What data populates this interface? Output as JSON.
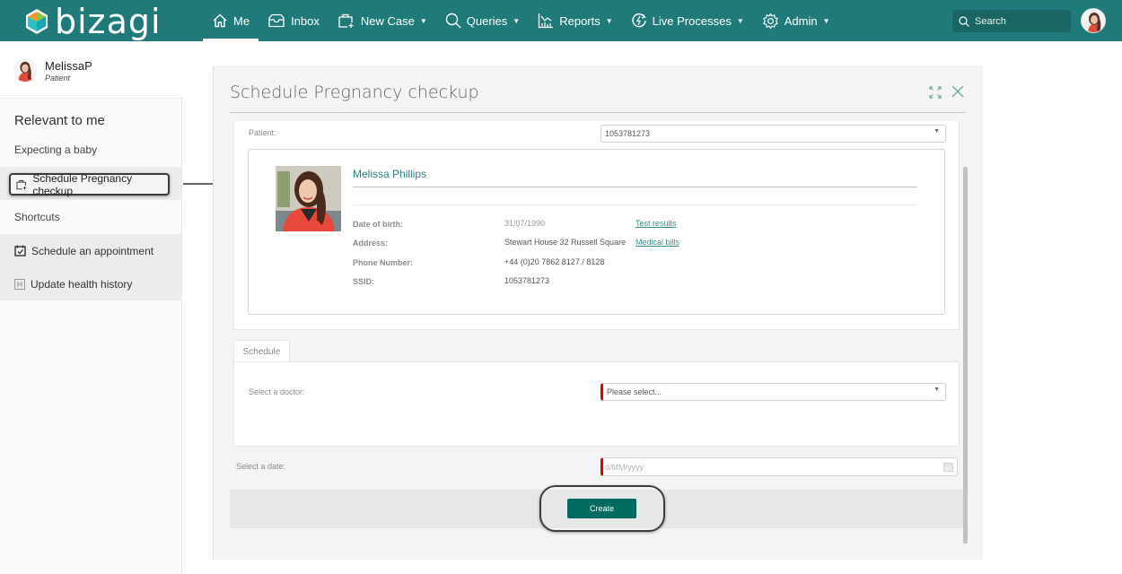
{
  "app": {
    "logo_text": "bizagi",
    "colors": {
      "brand": "#207a79",
      "accent": "#006b5f",
      "required": "#e30000",
      "link": "#3c8e8c"
    }
  },
  "nav": {
    "items": [
      {
        "label": "Me",
        "icon": "home-icon",
        "active": true,
        "has_dropdown": false
      },
      {
        "label": "Inbox",
        "icon": "inbox-icon",
        "active": false,
        "has_dropdown": false
      },
      {
        "label": "New Case",
        "icon": "new-case-icon",
        "active": false,
        "has_dropdown": true
      },
      {
        "label": "Queries",
        "icon": "search-icon",
        "active": false,
        "has_dropdown": true
      },
      {
        "label": "Reports",
        "icon": "chart-icon",
        "active": false,
        "has_dropdown": true
      },
      {
        "label": "Live Processes",
        "icon": "live-process-icon",
        "active": false,
        "has_dropdown": true
      },
      {
        "label": "Admin",
        "icon": "gear-icon",
        "active": false,
        "has_dropdown": true
      }
    ],
    "search_placeholder": "Search"
  },
  "sidebar": {
    "user": {
      "name": "MelissaP",
      "role": "Patient"
    },
    "section_title": "Relevant to me",
    "relevant_item": "Expecting a baby",
    "selected_item": "Schedule Pregnancy checkup",
    "shortcuts_title": "Shortcuts",
    "shortcuts": [
      {
        "label": "Schedule an appointment",
        "icon": "calendar-check-icon"
      },
      {
        "label": "Update health history",
        "icon": "health-history-icon"
      }
    ]
  },
  "modal": {
    "title": "Schedule Pregnancy checkup",
    "patient_label": "Patient:",
    "patient_value": "1053781273",
    "patient_card": {
      "name": "Melissa Phillips",
      "fields": [
        {
          "label": "Date of birth:",
          "value": "31/07/1990",
          "link": "Test results"
        },
        {
          "label": "Address:",
          "value": "Stewart House 32 Russell Square",
          "link": "Medical bills"
        },
        {
          "label": "Phone Number:",
          "value": "+44 (0)20 7862 8127 / 8128",
          "link": ""
        },
        {
          "label": "SSID:",
          "value": "1053781273",
          "link": ""
        }
      ]
    },
    "tab_label": "Schedule",
    "doctor_label": "Select a doctor:",
    "doctor_placeholder": "Please select...",
    "date_label": "Select a date:",
    "date_placeholder": "d/MM/yyyy",
    "create_label": "Create"
  }
}
